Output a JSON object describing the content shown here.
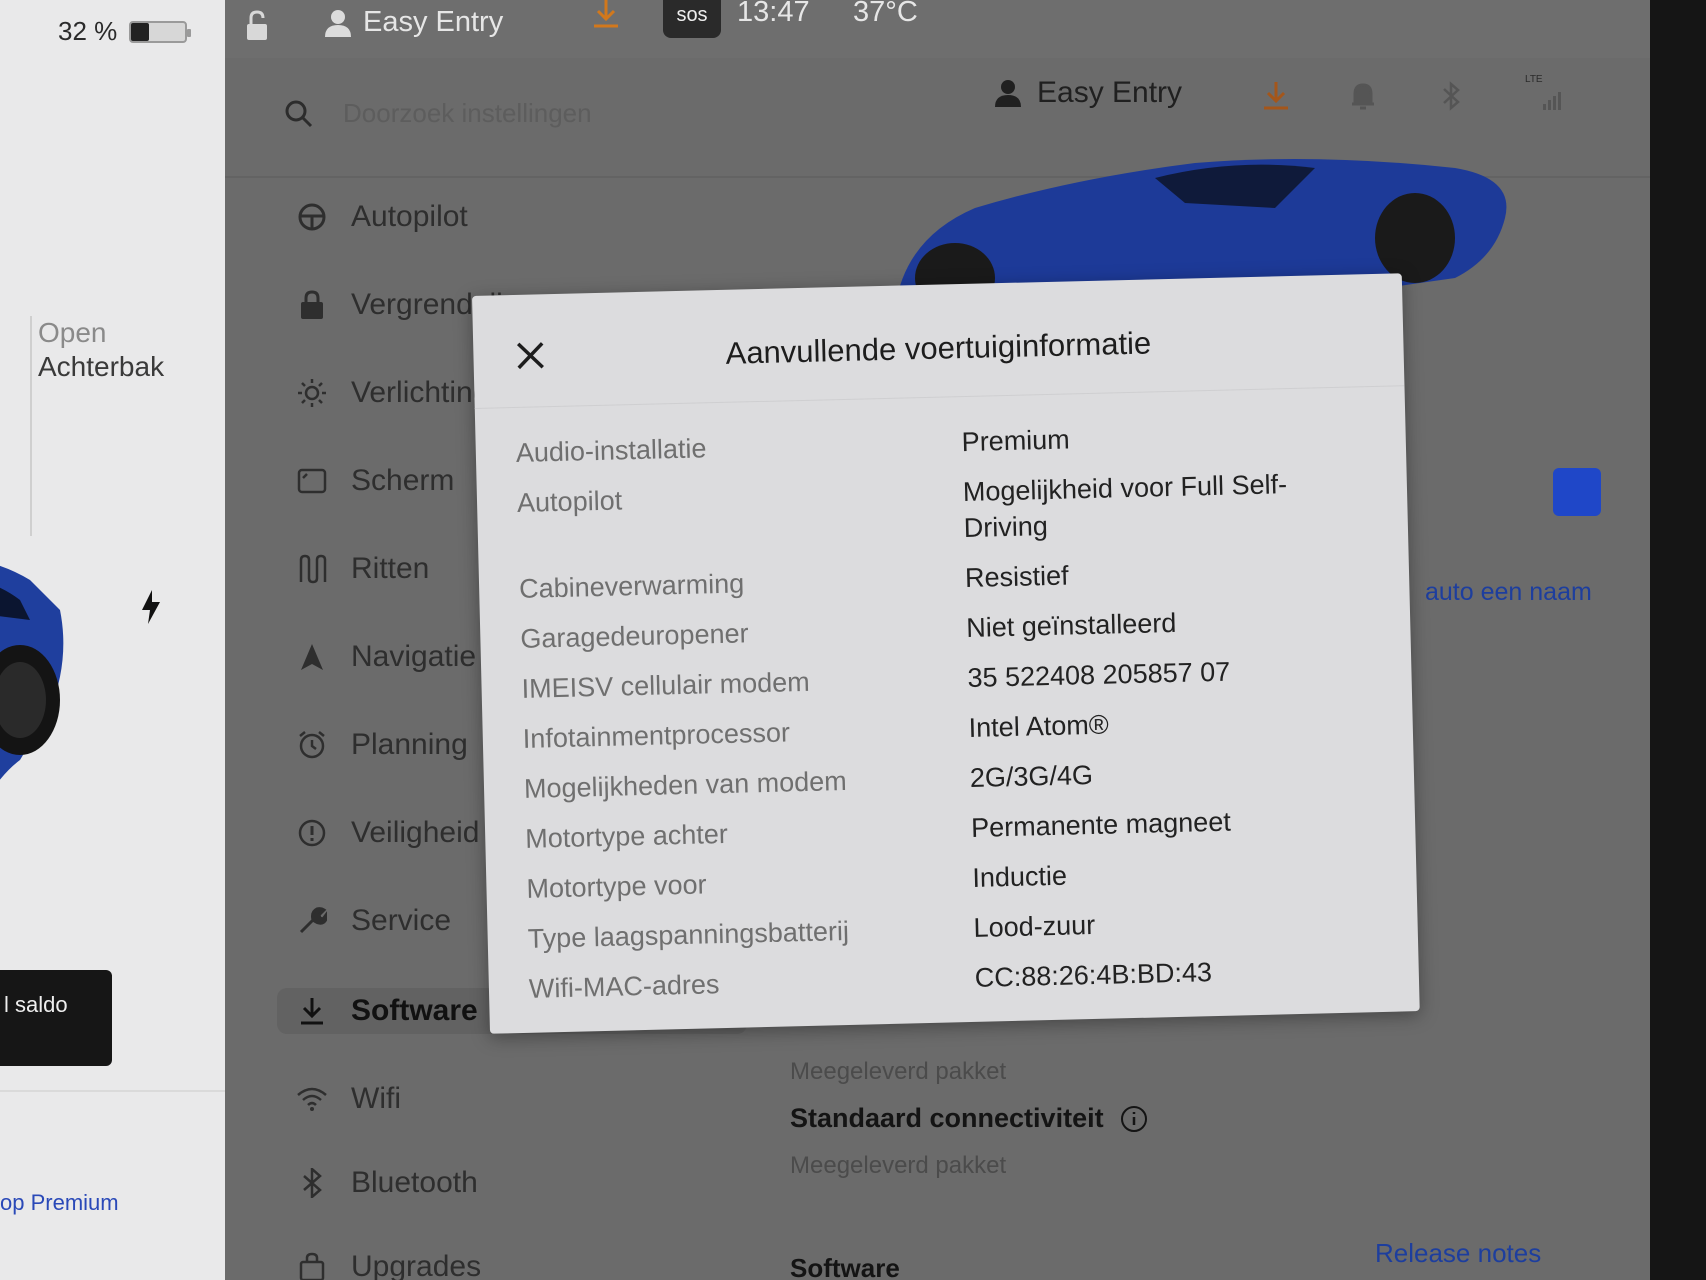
{
  "left_panel": {
    "battery_percent": "32 %",
    "battery_level": 0.32,
    "trunk_open_label": "Open",
    "trunk_name": "Achterbak",
    "saldo_label": "l saldo",
    "premium_link": "op Premium"
  },
  "status_bar": {
    "profile_name": "Easy Entry",
    "sos_label": "sos",
    "time": "13:47",
    "temperature": "37°C"
  },
  "search": {
    "placeholder": "Doorzoek instellingen"
  },
  "header": {
    "profile_name": "Easy Entry",
    "lte_label": "LTE"
  },
  "nav": {
    "items": [
      {
        "label": "Autopilot",
        "icon": "steering-wheel-icon"
      },
      {
        "label": "Vergrendeling",
        "icon": "lock-icon"
      },
      {
        "label": "Verlichting",
        "icon": "sun-icon"
      },
      {
        "label": "Scherm",
        "icon": "display-icon"
      },
      {
        "label": "Ritten",
        "icon": "trips-icon"
      },
      {
        "label": "Navigatie",
        "icon": "navigation-icon"
      },
      {
        "label": "Planning",
        "icon": "alarm-clock-icon"
      },
      {
        "label": "Veiligheid",
        "icon": "alert-circle-icon"
      },
      {
        "label": "Service",
        "icon": "wrench-icon"
      },
      {
        "label": "Software",
        "icon": "download-icon"
      },
      {
        "label": "Wifi",
        "icon": "wifi-icon"
      },
      {
        "label": "Bluetooth",
        "icon": "bluetooth-icon"
      },
      {
        "label": "Upgrades",
        "icon": "bag-icon"
      }
    ],
    "active": "Software"
  },
  "main": {
    "name_link": "auto een naam",
    "package_top": "Meegeleverd pakket",
    "connectivity_label": "Standaard connectiviteit",
    "connectivity_sub": "Meegeleverd pakket",
    "software_label": "Software",
    "release_notes": "Release notes"
  },
  "modal": {
    "title": "Aanvullende voertuiginformatie",
    "rows": [
      {
        "key": "Audio-installatie",
        "value": "Premium"
      },
      {
        "key": "Autopilot",
        "value": "Mogelijkheid voor Full Self-Driving"
      },
      {
        "key": "Cabineverwarming",
        "value": "Resistief"
      },
      {
        "key": "Garagedeuropener",
        "value": "Niet geïnstalleerd"
      },
      {
        "key": "IMEISV cellulair modem",
        "value": "35 522408 205857 07"
      },
      {
        "key": "Infotainmentprocessor",
        "value": "Intel Atom®"
      },
      {
        "key": "Mogelijkheden van modem",
        "value": "2G/3G/4G"
      },
      {
        "key": "Motortype achter",
        "value": "Permanente magneet"
      },
      {
        "key": "Motortype voor",
        "value": "Inductie"
      },
      {
        "key": "Type laagspanningsbatterij",
        "value": "Lood-zuur"
      },
      {
        "key": "Wifi-MAC-adres",
        "value": "CC:88:26:4B:BD:43"
      }
    ]
  },
  "colors": {
    "accent_blue": "#1f47c8",
    "download_orange": "#d2781c",
    "modal_bg": "#dcdcde"
  }
}
